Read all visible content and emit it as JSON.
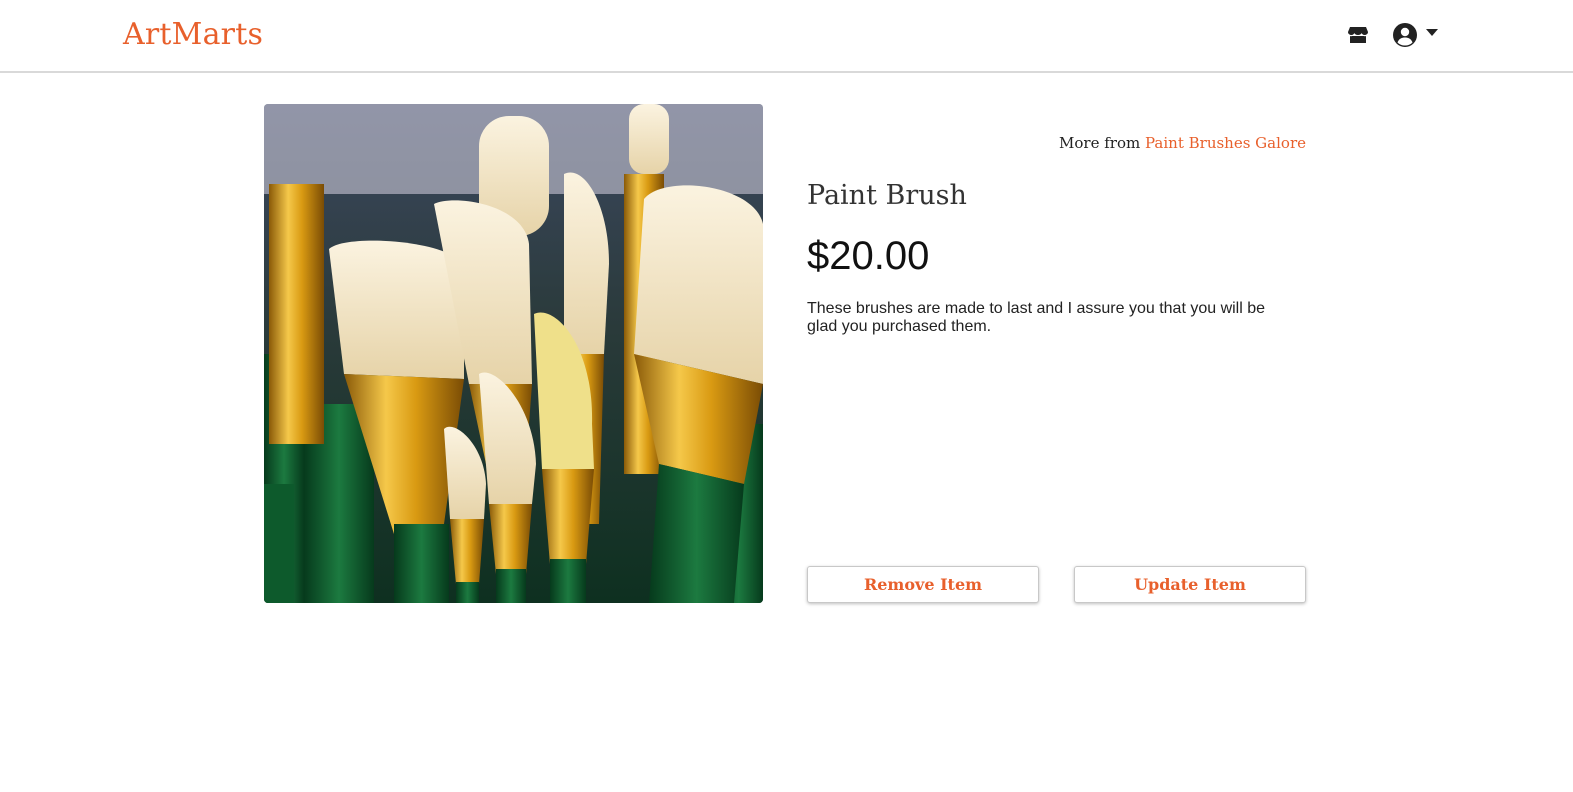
{
  "header": {
    "logo": "ArtMarts",
    "icons": {
      "store": "store-icon",
      "user": "user-circle-icon",
      "dropdown": "caret-down-icon"
    }
  },
  "product": {
    "more_from_prefix": "More from",
    "shop_name": "Paint Brushes Galore",
    "title": "Paint Brush",
    "price": "$20.00",
    "description": "These brushes are made to last and I assure you that you will be glad you purchased them.",
    "image_alt": "paint brushes"
  },
  "actions": {
    "remove_label": "Remove Item",
    "update_label": "Update Item"
  },
  "colors": {
    "accent": "#e8602c",
    "text": "#222222"
  }
}
